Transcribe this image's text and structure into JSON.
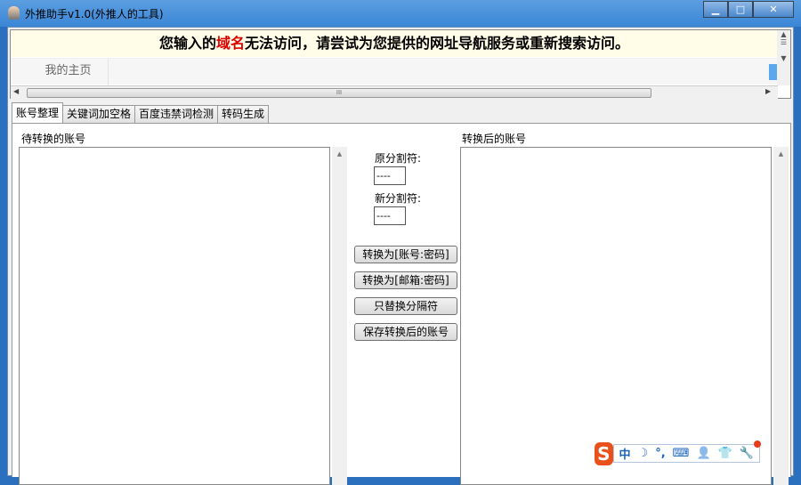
{
  "window": {
    "title": "外推助手v1.0(外推人的工具)",
    "min": "▁",
    "max": "□",
    "close": "✕"
  },
  "browser": {
    "banner_pre": "您输入的",
    "banner_red": "域名",
    "banner_post": "无法访问，请尝试为您提供的网址导航服务或重新搜索访问。",
    "home": "我的主页",
    "thumb_grip": "III"
  },
  "tabs": [
    "账号整理",
    "关键词加空格",
    "百度违禁词检测",
    "转码生成"
  ],
  "main": {
    "left_label": "待转换的账号",
    "right_label": "转换后的账号",
    "orig_sep_label": "原分割符:",
    "orig_sep_value": "----",
    "new_sep_label": "新分割符:",
    "new_sep_value": "----",
    "buttons": [
      "转换为[账号:密码]",
      "转换为[邮箱:密码]",
      "只替换分隔符",
      "保存转换后的账号"
    ]
  },
  "ime": {
    "logo": "S",
    "lang": "中",
    "moon": "☽",
    "punct": "°,",
    "keyboard": "⌨",
    "user": "👤",
    "skin": "👕",
    "tools": "🔧"
  }
}
